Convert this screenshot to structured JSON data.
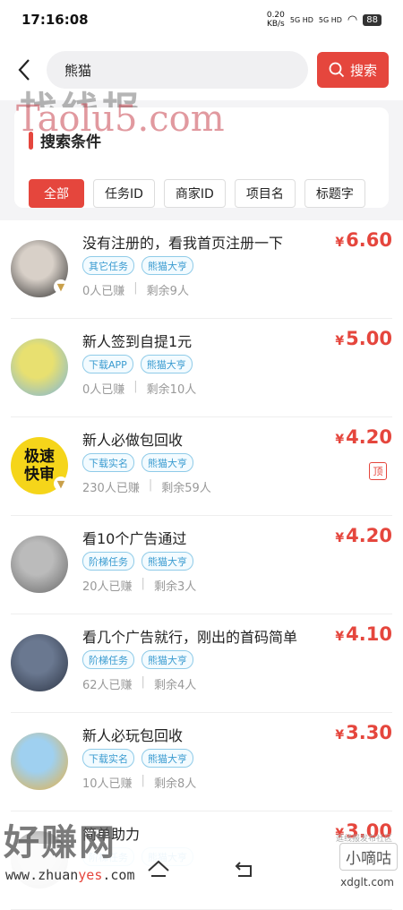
{
  "status_bar": {
    "time": "17:16:08",
    "net_speed_value": "0.20",
    "net_speed_unit": "KB/s",
    "signal1": "5G HD",
    "signal2": "5G HD",
    "battery": "88"
  },
  "search": {
    "query": "熊猫",
    "button_label": "搜索"
  },
  "filter": {
    "title": "搜索条件",
    "chips": [
      "全部",
      "任务ID",
      "商家ID",
      "项目名",
      "标题字"
    ]
  },
  "tasks": [
    {
      "title": "没有注册的，看我首页注册一下",
      "tags": [
        "其它任务",
        "熊猫大亨"
      ],
      "earned": "0人已赚",
      "remaining": "剩余9人",
      "price": "6.60",
      "currency": "¥",
      "badge": "",
      "avatar": "avatar-woman-dark-hair",
      "avatar_colors": [
        "#d8d0c8",
        "#2a2a2a"
      ],
      "verified": true
    },
    {
      "title": "新人签到自提1元",
      "tags": [
        "下载APP",
        "熊猫大亨"
      ],
      "earned": "0人已赚",
      "remaining": "剩余10人",
      "price": "5.00",
      "currency": "¥",
      "badge": "",
      "avatar": "avatar-cartoon-girl-cap",
      "avatar_colors": [
        "#e8e070",
        "#79b4e0"
      ],
      "verified": false
    },
    {
      "title": "新人必做包回收",
      "tags": [
        "下载实名",
        "熊猫大亨"
      ],
      "earned": "230人已赚",
      "remaining": "剩余59人",
      "price": "4.20",
      "currency": "¥",
      "badge": "顶",
      "avatar": "avatar-jisu-kuaishen-logo",
      "avatar_colors": [
        "#f5d51a",
        "#111111"
      ],
      "avatar_text1": "极速",
      "avatar_text2": "快审",
      "verified": true
    },
    {
      "title": "看10个广告通过",
      "tags": [
        "阶梯任务",
        "熊猫大亨"
      ],
      "earned": "20人已赚",
      "remaining": "剩余3人",
      "price": "4.20",
      "currency": "¥",
      "badge": "",
      "avatar": "avatar-anime-sketch",
      "avatar_colors": [
        "#bbbbbb",
        "#666666"
      ],
      "verified": false
    },
    {
      "title": "看几个广告就行，刚出的首码简单",
      "tags": [
        "阶梯任务",
        "熊猫大亨"
      ],
      "earned": "62人已赚",
      "remaining": "剩余4人",
      "price": "4.10",
      "currency": "¥",
      "badge": "",
      "avatar": "avatar-car-seat",
      "avatar_colors": [
        "#6a7890",
        "#2c3444"
      ],
      "verified": false
    },
    {
      "title": "新人必玩包回收",
      "tags": [
        "下载实名",
        "熊猫大亨"
      ],
      "earned": "10人已赚",
      "remaining": "剩余8人",
      "price": "3.30",
      "currency": "¥",
      "badge": "",
      "avatar": "avatar-cartoon-girl-flowers",
      "avatar_colors": [
        "#9fd0f0",
        "#e8b040"
      ],
      "verified": false
    },
    {
      "title": "简单助力",
      "tags": [
        "阶梯任务",
        "熊猫大亨"
      ],
      "earned": "",
      "remaining": "",
      "price": "3.00",
      "currency": "¥",
      "badge": "",
      "avatar": "avatar-partial",
      "avatar_colors": [
        "#cccccc",
        "#888888"
      ],
      "verified": false
    }
  ],
  "watermarks": {
    "top_logo": "找线报",
    "top_site": "Taolu5.com",
    "bottom_logo": "好赚网",
    "bottom_url_prefix": "www.zhuan",
    "bottom_url_highlight": "yes",
    "bottom_url_suffix": ".com",
    "bottom_right_logo": "小嘀咕",
    "bottom_right_small": "逛线报发布社区",
    "bottom_right_url": "xdglt.com"
  }
}
